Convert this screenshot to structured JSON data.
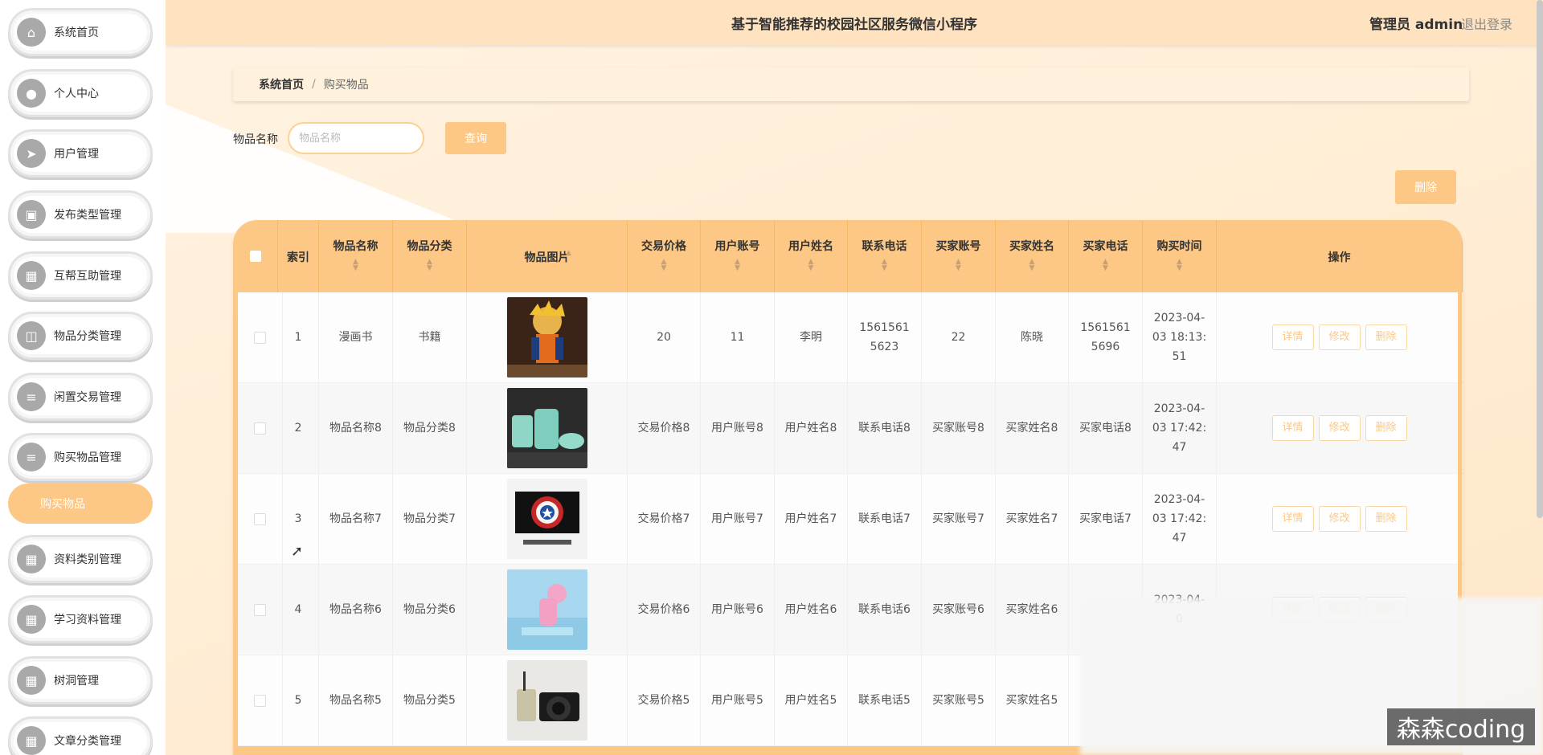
{
  "app": {
    "title": "基于智能推荐的校园社区服务微信小程序",
    "user": "管理员 admin",
    "logout": "退出登录"
  },
  "sidebar": {
    "items": [
      {
        "label": "系统首页",
        "icon": "home-icon",
        "glyph": "⌂"
      },
      {
        "label": "个人中心",
        "icon": "user-icon",
        "glyph": "●"
      },
      {
        "label": "用户管理",
        "icon": "send-icon",
        "glyph": "➤"
      },
      {
        "label": "发布类型管理",
        "icon": "briefcase-icon",
        "glyph": "▣"
      },
      {
        "label": "互帮互助管理",
        "icon": "grid-icon",
        "glyph": "▦"
      },
      {
        "label": "物品分类管理",
        "icon": "chart-icon",
        "glyph": "◫"
      },
      {
        "label": "闲置交易管理",
        "icon": "list-icon",
        "glyph": "≡"
      },
      {
        "label": "购买物品管理",
        "icon": "list-icon",
        "glyph": "≡"
      },
      {
        "label": "购买物品",
        "icon": "",
        "glyph": ""
      },
      {
        "label": "资料类别管理",
        "icon": "grid-icon",
        "glyph": "▦"
      },
      {
        "label": "学习资料管理",
        "icon": "grid-icon",
        "glyph": "▦"
      },
      {
        "label": "树洞管理",
        "icon": "grid-icon",
        "glyph": "▦"
      },
      {
        "label": "文章分类管理",
        "icon": "grid-icon",
        "glyph": "▦"
      }
    ]
  },
  "breadcrumb": {
    "home": "系统首页",
    "separator": "/",
    "current": "购买物品"
  },
  "search": {
    "label": "物品名称",
    "placeholder": "物品名称",
    "button": "查询"
  },
  "toolbar": {
    "delete": "删除"
  },
  "table": {
    "columns": [
      "索引",
      "物品名称",
      "物品分类",
      "物品图片",
      "交易价格",
      "用户账号",
      "用户姓名",
      "联系电话",
      "买家账号",
      "买家姓名",
      "买家电话",
      "购买时间",
      "操作"
    ],
    "rows": [
      {
        "index": "1",
        "name": "漫画书",
        "category": "书籍",
        "image": "anime-figure",
        "price": "20",
        "account": "11",
        "username": "李明",
        "phone": "15615615623",
        "buyer_account": "22",
        "buyer_name": "陈晓",
        "buyer_phone": "15615615696",
        "time": "2023-04-03 18:13:51"
      },
      {
        "index": "2",
        "name": "物品名称8",
        "category": "物品分类8",
        "image": "teal-ceramics",
        "price": "交易价格8",
        "account": "用户账号8",
        "username": "用户姓名8",
        "phone": "联系电话8",
        "buyer_account": "买家账号8",
        "buyer_name": "买家姓名8",
        "buyer_phone": "买家电话8",
        "time": "2023-04-03 17:42:47"
      },
      {
        "index": "3",
        "name": "物品名称7",
        "category": "物品分类7",
        "image": "monitor-shield",
        "price": "交易价格7",
        "account": "用户账号7",
        "username": "用户姓名7",
        "phone": "联系电话7",
        "buyer_account": "买家账号7",
        "buyer_name": "买家姓名7",
        "buyer_phone": "买家电话7",
        "time": "2023-04-03 17:42:47"
      },
      {
        "index": "4",
        "name": "物品名称6",
        "category": "物品分类6",
        "image": "pink-toy",
        "price": "交易价格6",
        "account": "用户账号6",
        "username": "用户姓名6",
        "phone": "联系电话6",
        "buyer_account": "买家账号6",
        "buyer_name": "买家姓名6",
        "buyer_phone": "",
        "time": "2023-04-0"
      },
      {
        "index": "5",
        "name": "物品名称5",
        "category": "物品分类5",
        "image": "camera-cup",
        "price": "交易价格5",
        "account": "用户账号5",
        "username": "用户姓名5",
        "phone": "联系电话5",
        "buyer_account": "买家账号5",
        "buyer_name": "买家姓名5",
        "buyer_phone": "",
        "time": ""
      }
    ],
    "actions": {
      "detail": "详情",
      "edit": "修改",
      "delete": "删除"
    }
  },
  "watermark": "森森coding",
  "colors": {
    "accent": "#fdc785",
    "header_bg": "#ffe3c0",
    "page_bg": "#fff3e2"
  }
}
